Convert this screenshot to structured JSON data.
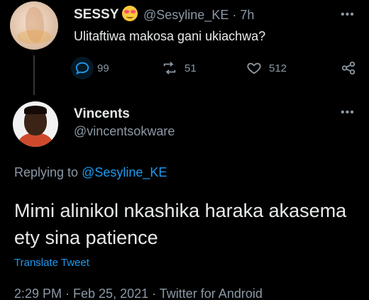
{
  "original_tweet": {
    "display_name": "SESSY",
    "handle_time": "@Sesyline_KE · 7h",
    "text": "Ulitaftiwa makosa gani ukiachwa?",
    "more": "•••",
    "replies": "99",
    "retweets": "51",
    "likes": "512"
  },
  "reply_tweet": {
    "display_name": "Vincents",
    "handle": "@vincentsokware",
    "more": "•••",
    "replying_prefix": "Replying to ",
    "replying_to": "@Sesyline_KE",
    "text": "Mimi alinikol nkashika haraka akasema ety sina patience",
    "translate": "Translate Tweet",
    "meta": "2:29 PM · Feb 25, 2021 · Twitter for Android"
  },
  "colors": {
    "background": "#000000",
    "text": "#e7e9ea",
    "muted": "#8b98a5",
    "accent": "#1d9bf0"
  },
  "icons": [
    "reply-icon",
    "retweet-icon",
    "like-icon",
    "share-icon",
    "more-icon",
    "face-emoji-icon"
  ]
}
